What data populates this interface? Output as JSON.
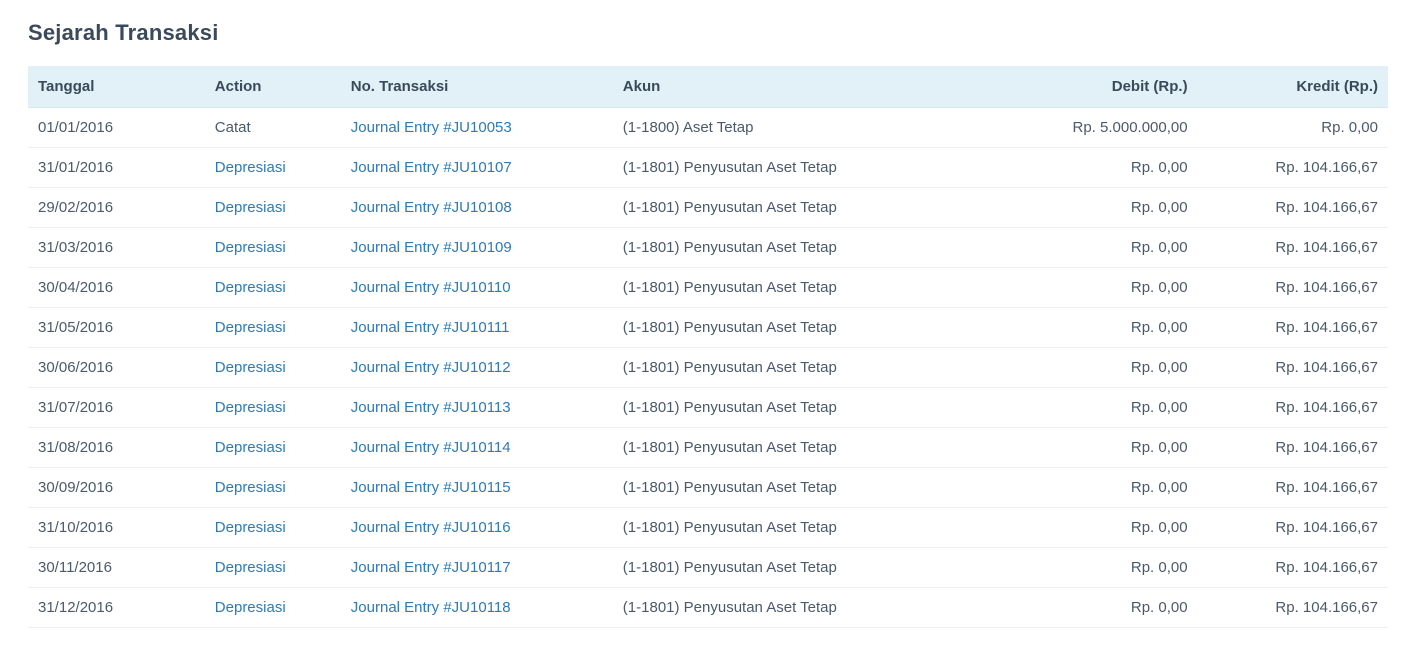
{
  "title": "Sejarah Transaksi",
  "columns": {
    "date": "Tanggal",
    "action": "Action",
    "txn": "No. Transaksi",
    "account": "Akun",
    "debit": "Debit (Rp.)",
    "credit": "Kredit (Rp.)"
  },
  "rows": [
    {
      "date": "01/01/2016",
      "action": "Catat",
      "action_link": false,
      "txn": "Journal Entry #JU10053",
      "account": "(1-1800) Aset Tetap",
      "debit": "Rp. 5.000.000,00",
      "credit": "Rp. 0,00"
    },
    {
      "date": "31/01/2016",
      "action": "Depresiasi",
      "action_link": true,
      "txn": "Journal Entry #JU10107",
      "account": "(1-1801) Penyusutan Aset Tetap",
      "debit": "Rp. 0,00",
      "credit": "Rp. 104.166,67"
    },
    {
      "date": "29/02/2016",
      "action": "Depresiasi",
      "action_link": true,
      "txn": "Journal Entry #JU10108",
      "account": "(1-1801) Penyusutan Aset Tetap",
      "debit": "Rp. 0,00",
      "credit": "Rp. 104.166,67"
    },
    {
      "date": "31/03/2016",
      "action": "Depresiasi",
      "action_link": true,
      "txn": "Journal Entry #JU10109",
      "account": "(1-1801) Penyusutan Aset Tetap",
      "debit": "Rp. 0,00",
      "credit": "Rp. 104.166,67"
    },
    {
      "date": "30/04/2016",
      "action": "Depresiasi",
      "action_link": true,
      "txn": "Journal Entry #JU10110",
      "account": "(1-1801) Penyusutan Aset Tetap",
      "debit": "Rp. 0,00",
      "credit": "Rp. 104.166,67"
    },
    {
      "date": "31/05/2016",
      "action": "Depresiasi",
      "action_link": true,
      "txn": "Journal Entry #JU10111",
      "account": "(1-1801) Penyusutan Aset Tetap",
      "debit": "Rp. 0,00",
      "credit": "Rp. 104.166,67"
    },
    {
      "date": "30/06/2016",
      "action": "Depresiasi",
      "action_link": true,
      "txn": "Journal Entry #JU10112",
      "account": "(1-1801) Penyusutan Aset Tetap",
      "debit": "Rp. 0,00",
      "credit": "Rp. 104.166,67"
    },
    {
      "date": "31/07/2016",
      "action": "Depresiasi",
      "action_link": true,
      "txn": "Journal Entry #JU10113",
      "account": "(1-1801) Penyusutan Aset Tetap",
      "debit": "Rp. 0,00",
      "credit": "Rp. 104.166,67"
    },
    {
      "date": "31/08/2016",
      "action": "Depresiasi",
      "action_link": true,
      "txn": "Journal Entry #JU10114",
      "account": "(1-1801) Penyusutan Aset Tetap",
      "debit": "Rp. 0,00",
      "credit": "Rp. 104.166,67"
    },
    {
      "date": "30/09/2016",
      "action": "Depresiasi",
      "action_link": true,
      "txn": "Journal Entry #JU10115",
      "account": "(1-1801) Penyusutan Aset Tetap",
      "debit": "Rp. 0,00",
      "credit": "Rp. 104.166,67"
    },
    {
      "date": "31/10/2016",
      "action": "Depresiasi",
      "action_link": true,
      "txn": "Journal Entry #JU10116",
      "account": "(1-1801) Penyusutan Aset Tetap",
      "debit": "Rp. 0,00",
      "credit": "Rp. 104.166,67"
    },
    {
      "date": "30/11/2016",
      "action": "Depresiasi",
      "action_link": true,
      "txn": "Journal Entry #JU10117",
      "account": "(1-1801) Penyusutan Aset Tetap",
      "debit": "Rp. 0,00",
      "credit": "Rp. 104.166,67"
    },
    {
      "date": "31/12/2016",
      "action": "Depresiasi",
      "action_link": true,
      "txn": "Journal Entry #JU10118",
      "account": "(1-1801) Penyusutan Aset Tetap",
      "debit": "Rp. 0,00",
      "credit": "Rp. 104.166,67"
    }
  ]
}
